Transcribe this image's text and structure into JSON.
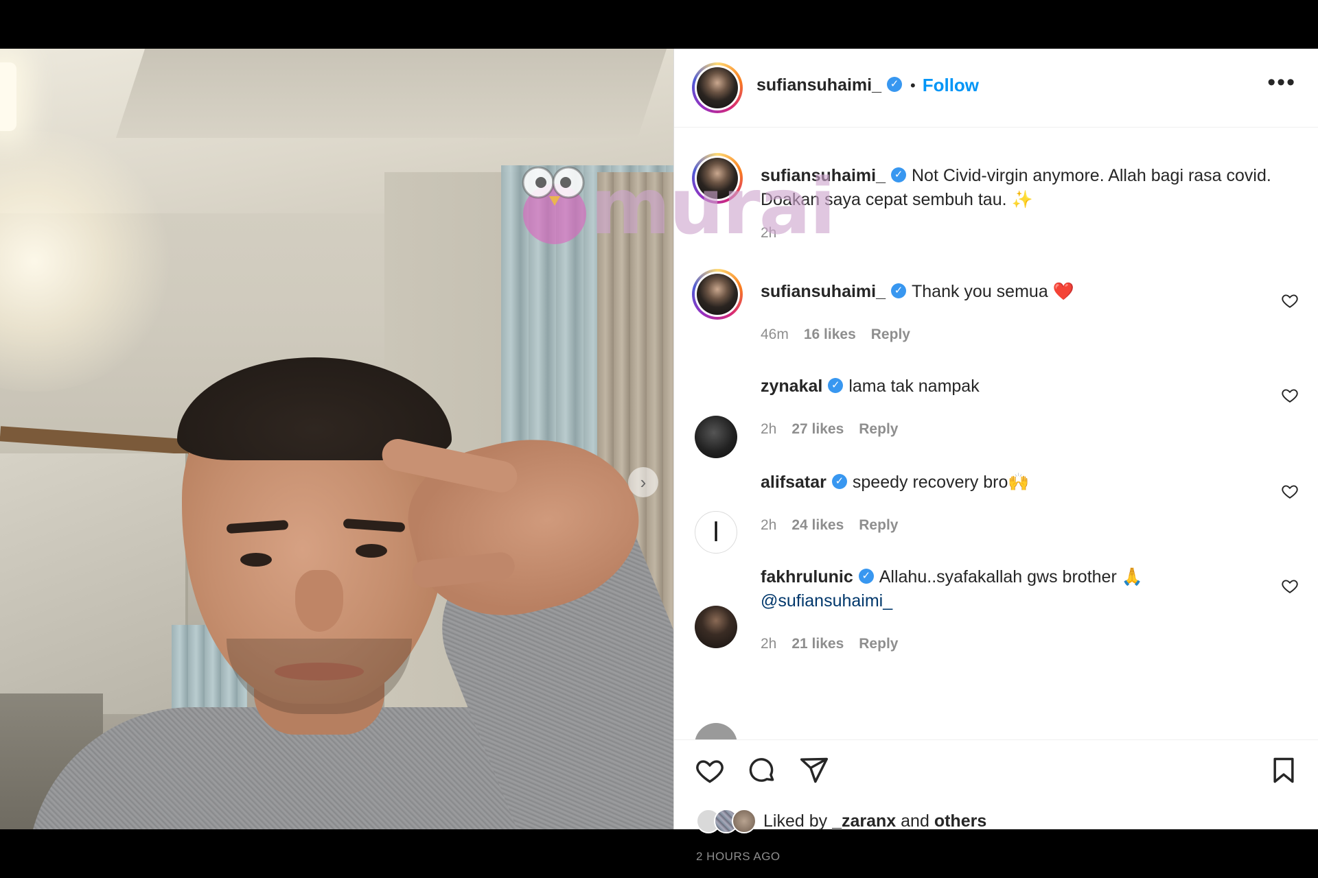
{
  "post": {
    "username": "sufiansuhaimi_",
    "follow_label": "Follow",
    "more_label": "•••",
    "verified_mark": "✓"
  },
  "watermark": {
    "text": "murai"
  },
  "photo": {
    "next_arrow": "›"
  },
  "caption": {
    "username": "sufiansuhaimi_",
    "text": "Not Civid-virgin anymore. Allah bagi rasa covid. Doakan saya cepat sembuh tau. ✨",
    "time": "2h"
  },
  "comments": [
    {
      "username": "sufiansuhaimi_",
      "text": "Thank you semua ❤️",
      "time": "46m",
      "likes": "16 likes",
      "reply": "Reply"
    },
    {
      "username": "zynakal",
      "text": "lama tak nampak",
      "time": "2h",
      "likes": "27 likes",
      "reply": "Reply"
    },
    {
      "username": "alifsatar",
      "text": "speedy recovery bro🙌",
      "time": "2h",
      "likes": "24 likes",
      "reply": "Reply"
    },
    {
      "username": "fakhrulunic",
      "text": "Allahu..syafakallah gws brother 🙏",
      "mention": "@sufiansuhaimi_",
      "time": "2h",
      "likes": "21 likes",
      "reply": "Reply"
    }
  ],
  "footer": {
    "liked_by_prefix": "Liked by",
    "liked_by_user": "_zaranx",
    "liked_by_and": "and",
    "liked_by_others": "others",
    "timestamp": "2 HOURS AGO"
  },
  "icons": {
    "like": "heart-icon",
    "comment": "comment-icon",
    "share": "share-icon",
    "save": "bookmark-icon"
  },
  "colors": {
    "follow": "#0095f6",
    "verified": "#3897f0",
    "text": "#262626",
    "muted": "#8e8e8e"
  }
}
